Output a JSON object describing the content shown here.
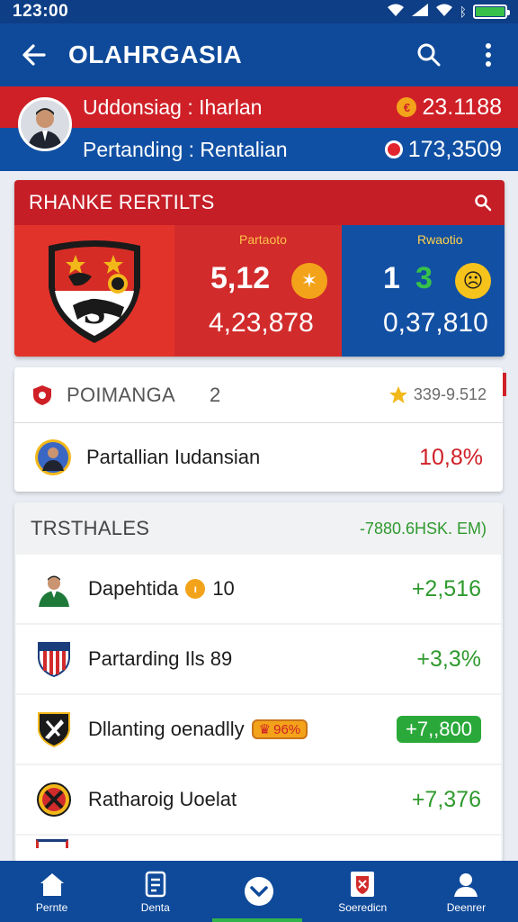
{
  "status_bar": {
    "time": "123:00"
  },
  "app_bar": {
    "title": "OLAHRGASIA",
    "back_icon": "arrow-left-icon",
    "search_icon": "search-icon",
    "menu_icon": "more-vertical-icon"
  },
  "banner": {
    "row1_text": "Uddonsiag : Iharlan",
    "row1_value": "23.1188",
    "row2_text": "Pertanding : Rentalian",
    "row2_value": "173,3509"
  },
  "ranking": {
    "title": "RHANKE RERTILTS",
    "mid_label": "Partaoto",
    "mid_big": "5,12",
    "mid_small": "4,23,878",
    "right_label": "Rwaotio",
    "right_big_a": "1",
    "right_big_b": "3",
    "right_small": "0,37,810",
    "colors": {
      "red": "#d22b2b",
      "blue": "#1250a3",
      "gold": "#f3a31a"
    }
  },
  "position": {
    "label": "POIMANGA",
    "count": "2",
    "rating": "339-9.512",
    "player": "Partallian Iudansian",
    "percent": "10,8%"
  },
  "transfers": {
    "title": "TRSTHALES",
    "header_value": "-7880.6HSK. EM)",
    "rows": [
      {
        "name": "Dapehtida",
        "badge": "10",
        "value": "+2,516"
      },
      {
        "name": "Partarding Ils 89",
        "badge": "",
        "value": "+3,3%"
      },
      {
        "name": "Dllanting oenadlly",
        "badge": "96%",
        "value": "+7,,800"
      },
      {
        "name": "Ratharoig Uoelat",
        "badge": "",
        "value": "+7,376"
      }
    ]
  },
  "bottom_nav": [
    {
      "label": "Pernte",
      "icon": "home-icon"
    },
    {
      "label": "Denta",
      "icon": "stats-icon"
    },
    {
      "label": "",
      "icon": "chevron-down-icon"
    },
    {
      "label": "Soeredicn",
      "icon": "club-icon"
    },
    {
      "label": "Deenrer",
      "icon": "profile-icon"
    }
  ]
}
